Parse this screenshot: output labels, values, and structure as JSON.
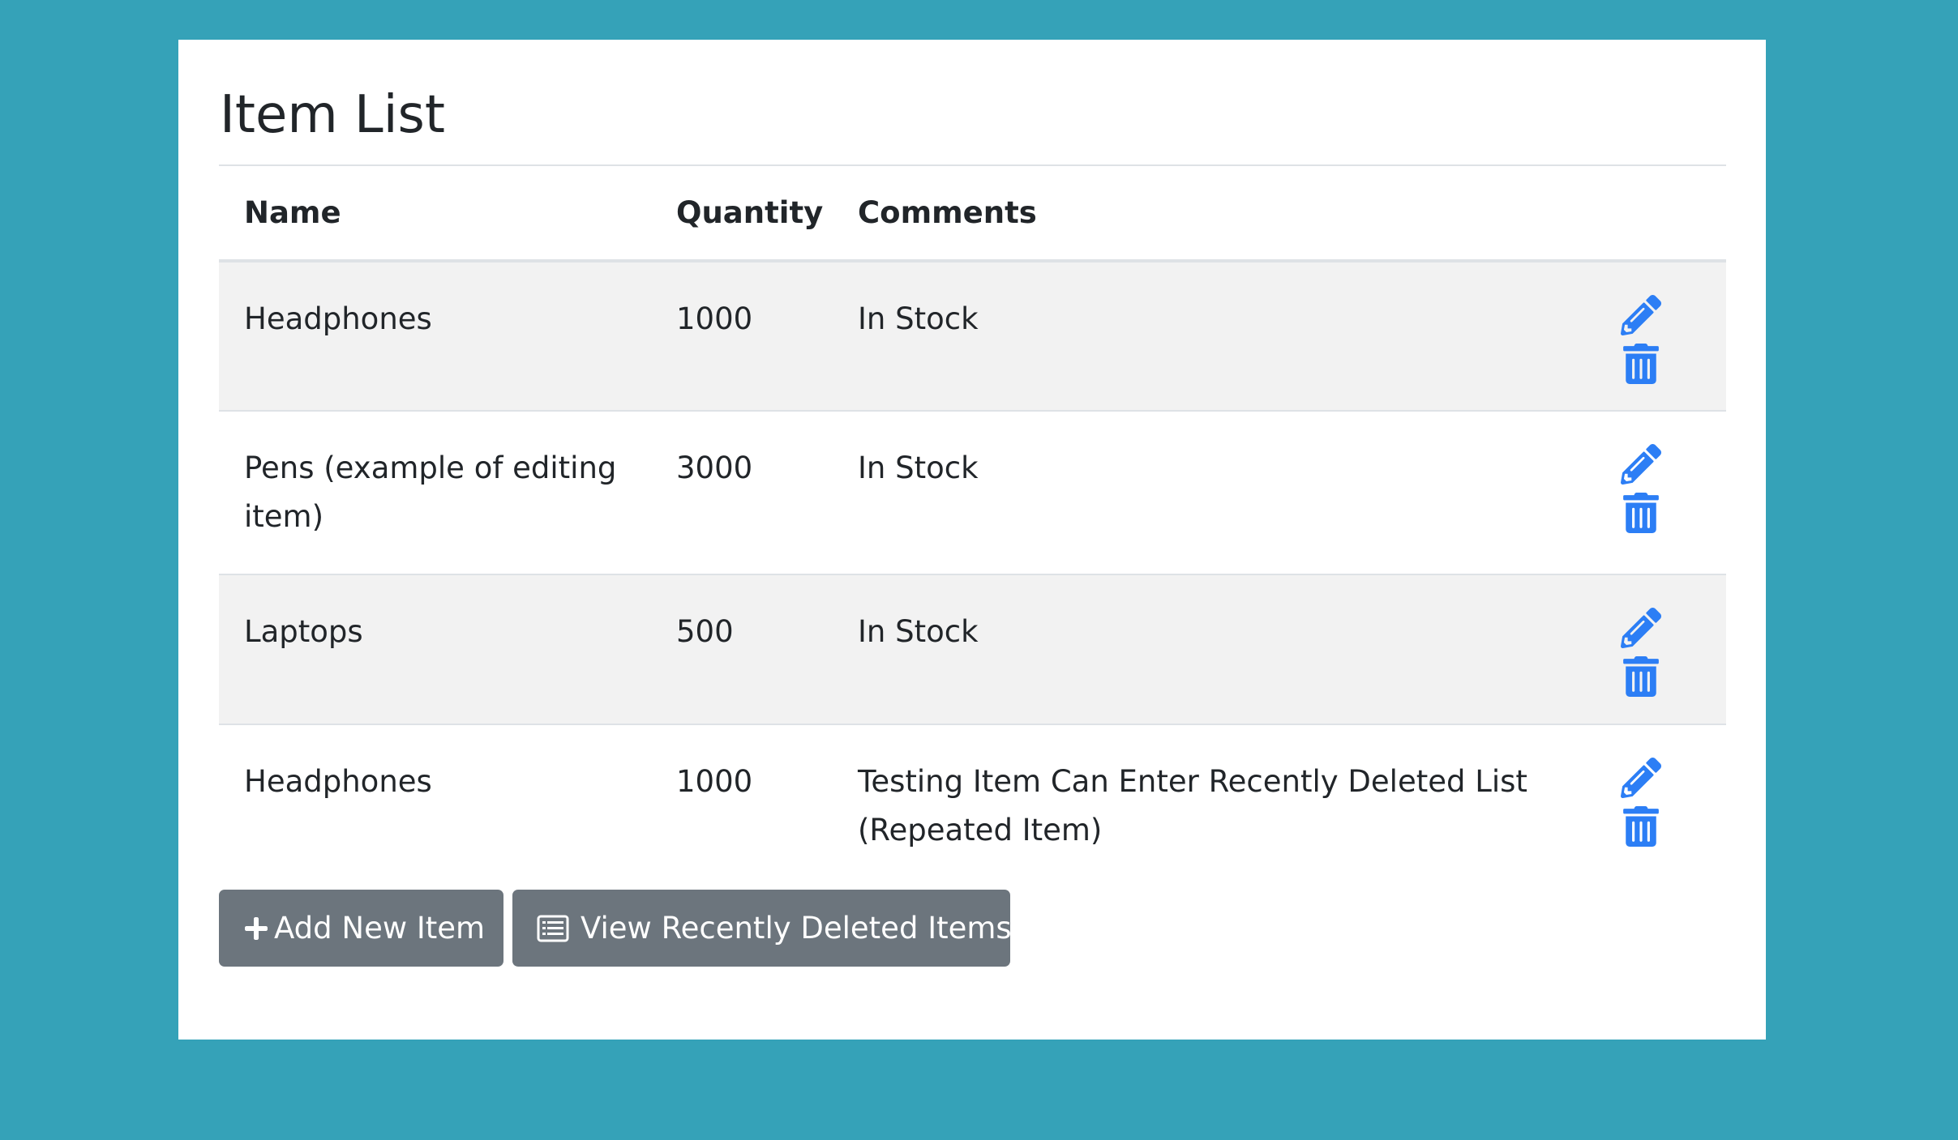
{
  "page": {
    "title": "Item List"
  },
  "table": {
    "headers": {
      "name": "Name",
      "quantity": "Quantity",
      "comments": "Comments"
    },
    "rows": [
      {
        "name": "Headphones",
        "quantity": "1000",
        "comments": "In Stock",
        "edit_icon": "pencil-icon",
        "delete_icon": "trash-icon"
      },
      {
        "name": "Pens (example of editing item)",
        "quantity": "3000",
        "comments": "In Stock",
        "edit_icon": "pencil-icon",
        "delete_icon": "trash-icon"
      },
      {
        "name": "Laptops",
        "quantity": "500",
        "comments": "In Stock",
        "edit_icon": "pencil-icon",
        "delete_icon": "trash-icon"
      },
      {
        "name": "Headphones",
        "quantity": "1000",
        "comments": "Testing Item Can Enter Recently Deleted List (Repeated Item)",
        "edit_icon": "pencil-icon",
        "delete_icon": "trash-icon"
      }
    ]
  },
  "buttons": {
    "add_label": "Add New Item",
    "add_icon": "plus-icon",
    "view_deleted_label": "View Recently Deleted Items",
    "view_deleted_icon": "list-alt-icon"
  },
  "colors": {
    "background": "#35a2b8",
    "card": "#ffffff",
    "icon": "#2c7ef5",
    "button": "#6c757d",
    "stripe": "#f2f2f2"
  }
}
